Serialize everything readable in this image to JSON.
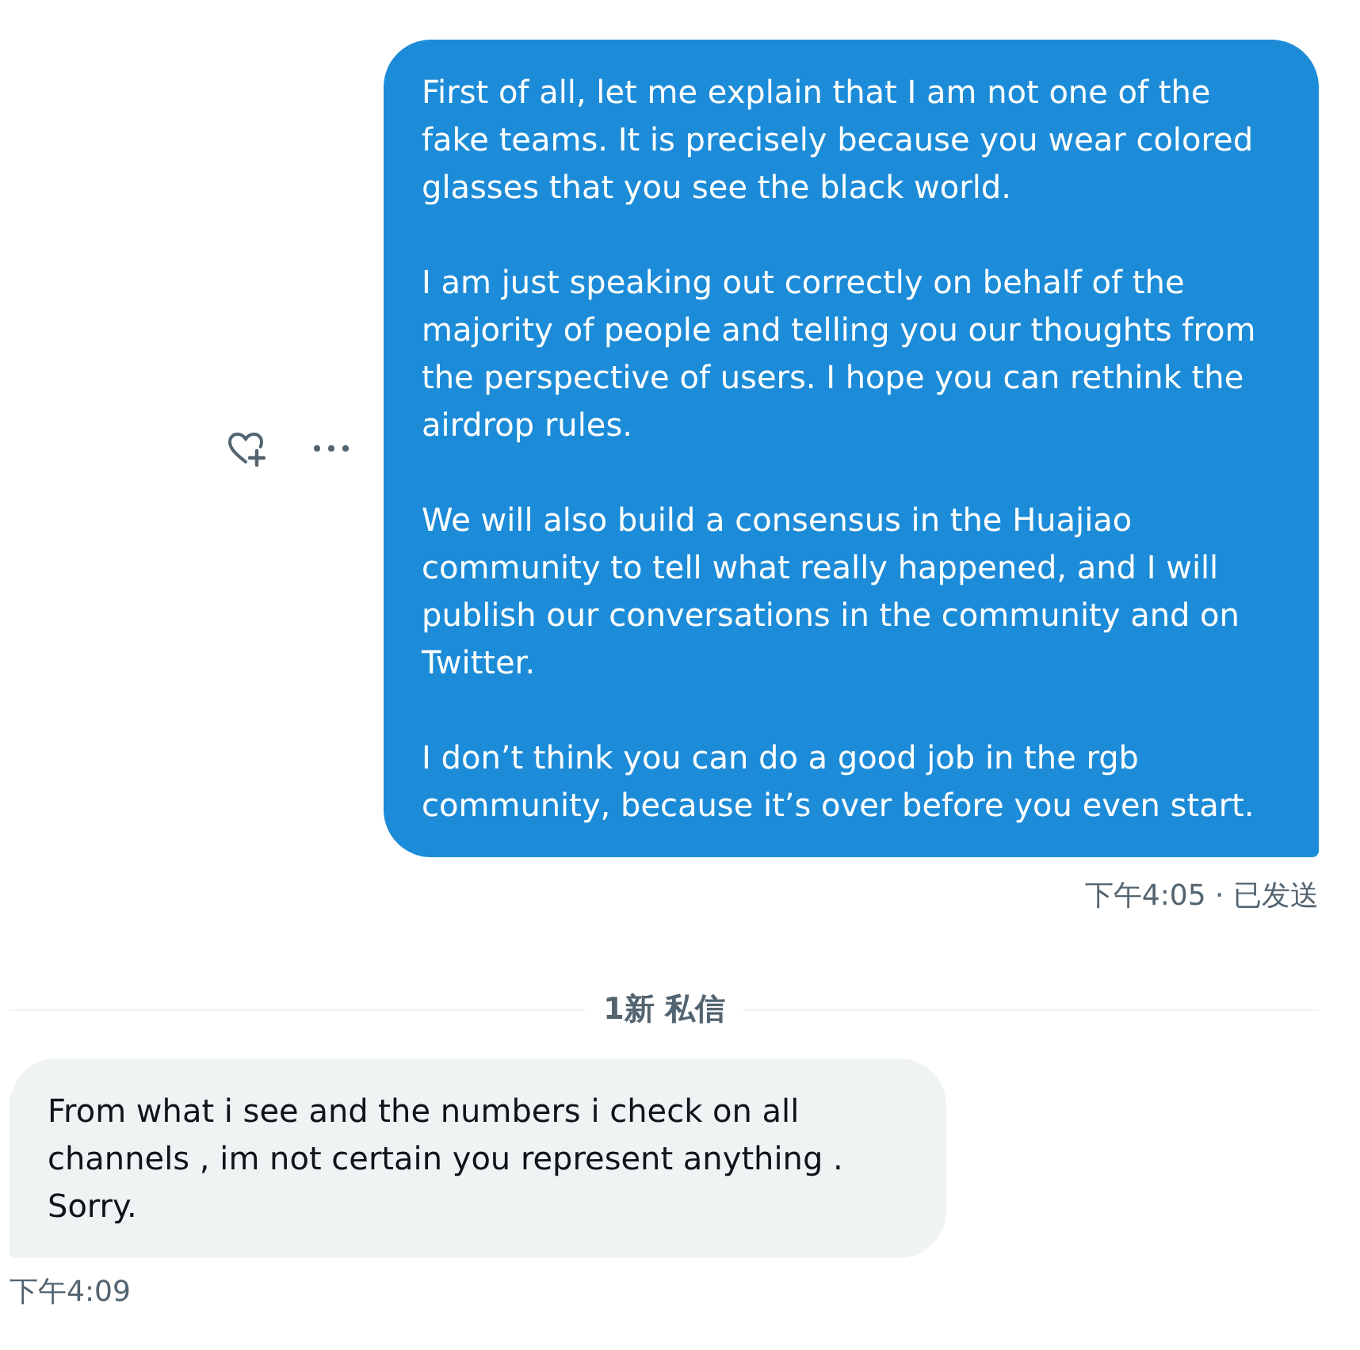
{
  "thread": [
    {
      "kind": "sent",
      "paragraphs": [
        "First of all, let me explain that I am not one of the fake teams. It is precisely because you wear colored glasses that you see the black world.",
        "I am just speaking out correctly on behalf of the majority of people and telling you our thoughts from the perspective of users. I hope you can rethink the airdrop rules.",
        "We will also build a consensus in the Huajiao community to tell what really happened, and I will publish our conversations in the community and on Twitter.",
        "I don’t think you can do a good job in the rgb community, because it’s over before you even start."
      ],
      "timestamp": "下午4:05 · 已发送"
    },
    {
      "kind": "divider",
      "label": "1新 私信"
    },
    {
      "kind": "received",
      "paragraphs": [
        "From what i see and the numbers i check on all channels , im not certain you represent anything . Sorry."
      ],
      "timestamp": "下午4:09"
    }
  ]
}
